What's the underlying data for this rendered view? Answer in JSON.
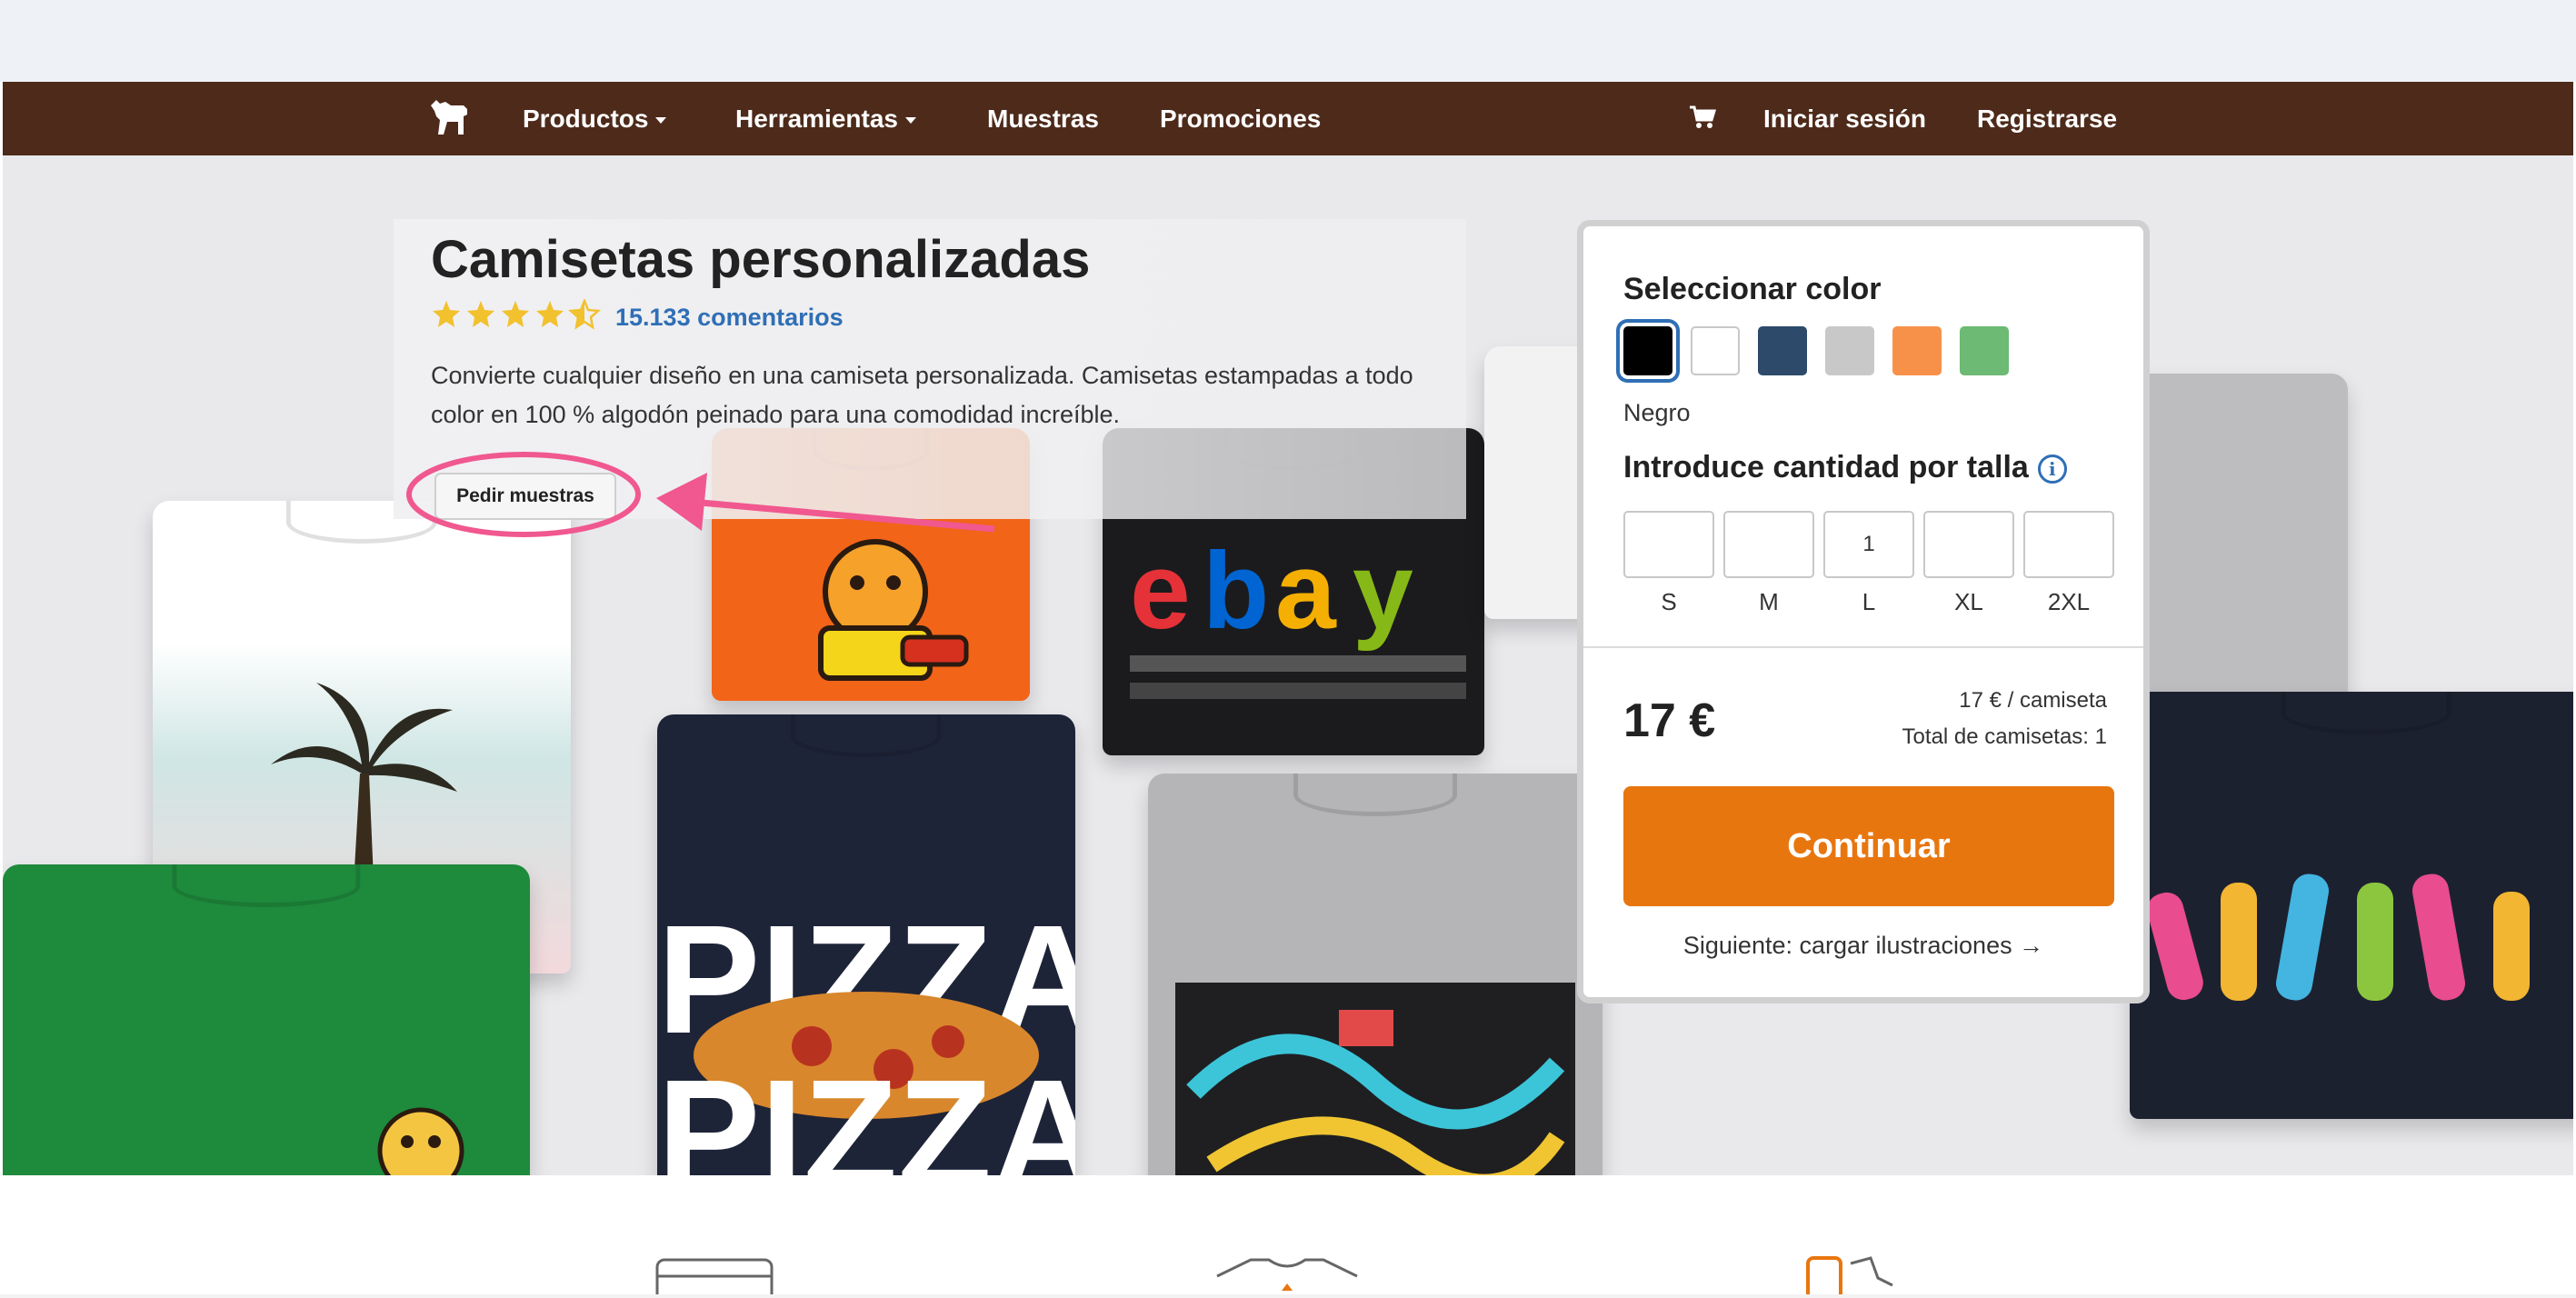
{
  "nav": {
    "items": [
      {
        "label": "Productos",
        "dropdown": true
      },
      {
        "label": "Herramientas",
        "dropdown": true
      },
      {
        "label": "Muestras",
        "dropdown": false
      },
      {
        "label": "Promociones",
        "dropdown": false
      }
    ],
    "login": "Iniciar sesión",
    "register": "Registrarse",
    "logo_icon": "horse-logo-icon",
    "cart_icon": "cart-icon"
  },
  "hero": {
    "title": "Camisetas personalizadas",
    "rating": 4.5,
    "reviews": "15.133 comentarios",
    "description": "Convierte cualquier diseño en una camiseta personalizada. Camisetas estampadas a todo color en 100 % algodón peinado para una comodidad increíble.",
    "samples_button": "Pedir muestras"
  },
  "panel": {
    "color_heading": "Seleccionar color",
    "colors": [
      {
        "name": "Negro",
        "hex": "#000000",
        "selected": true
      },
      {
        "name": "Blanco",
        "hex": "#ffffff",
        "selected": false
      },
      {
        "name": "Azul marino",
        "hex": "#2d4a6b",
        "selected": false
      },
      {
        "name": "Gris",
        "hex": "#c8c8c8",
        "selected": false
      },
      {
        "name": "Naranja",
        "hex": "#f7914a",
        "selected": false
      },
      {
        "name": "Verde",
        "hex": "#6cba73",
        "selected": false
      }
    ],
    "selected_color": "Negro",
    "qty_heading": "Introduce cantidad por talla",
    "sizes": [
      {
        "label": "S",
        "value": ""
      },
      {
        "label": "M",
        "value": ""
      },
      {
        "label": "L",
        "value": "1"
      },
      {
        "label": "XL",
        "value": ""
      },
      {
        "label": "2XL",
        "value": ""
      }
    ],
    "price": "17 €",
    "unit_price": "17 € / camiseta",
    "total": "Total de camisetas: 1",
    "continue_button": "Continuar",
    "next_link": "Siguiente: cargar ilustraciones →"
  },
  "colors": {
    "navbar": "#4d2a1a",
    "accent": "#e8760f",
    "link": "#2f6fb6",
    "star": "#f2c12e",
    "annotation": "#f0588f"
  }
}
